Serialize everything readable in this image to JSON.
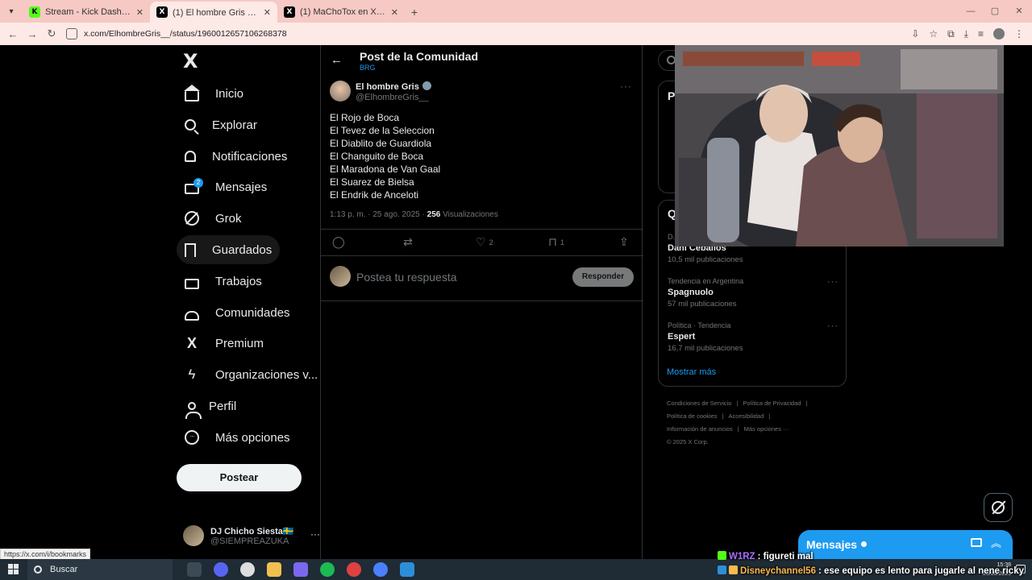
{
  "browser": {
    "tabs": [
      {
        "title": "Stream - Kick Dashboard",
        "favicon": "K",
        "favicon_color": "#53fc18",
        "active": false
      },
      {
        "title": "(1) El hombre Gris ◯ en X: \"@...",
        "favicon": "X",
        "favicon_color": "#000000",
        "active": true
      },
      {
        "title": "(1) MaChoTox en X: \"La verdad...",
        "favicon": "X",
        "favicon_color": "#000000",
        "active": false
      }
    ],
    "new_tab": "+",
    "url": "x.com/ElhombreGris__/status/1960012657106268378",
    "status_url": "https://x.com/i/bookmarks"
  },
  "nav": {
    "logo": "X",
    "items": [
      {
        "label": "Inicio",
        "icon": "home-icon"
      },
      {
        "label": "Explorar",
        "icon": "search-icon"
      },
      {
        "label": "Notificaciones",
        "icon": "bell-icon"
      },
      {
        "label": "Mensajes",
        "icon": "mail-icon",
        "badge": "2"
      },
      {
        "label": "Grok",
        "icon": "grok-icon"
      },
      {
        "label": "Guardados",
        "icon": "bookmark-icon"
      },
      {
        "label": "Trabajos",
        "icon": "briefcase-icon"
      },
      {
        "label": "Comunidades",
        "icon": "communities-icon"
      },
      {
        "label": "Premium",
        "icon": "x-icon"
      },
      {
        "label": "Organizaciones v...",
        "icon": "bolt-icon"
      },
      {
        "label": "Perfil",
        "icon": "person-icon"
      },
      {
        "label": "Más opciones",
        "icon": "more-icon"
      }
    ],
    "post_button": "Postear",
    "account": {
      "name": "DJ Chicho Siesta🇸🇪",
      "handle": "@SIEMPREAZUKA",
      "menu": "···"
    }
  },
  "main": {
    "back": "←",
    "title": "Post de la Comunidad",
    "subtitle": "BRG",
    "post": {
      "author_name": "El hombre Gris",
      "author_handle": "@ElhombreGris__",
      "more": "···",
      "lines": [
        "El Rojo de Boca",
        "El Tevez de la Seleccion",
        "El Diablito de Guardiola",
        "El Changuito de Boca",
        "El Maradona de Van Gaal",
        "El Suarez de Bielsa",
        "El Endrik de Anceloti"
      ],
      "time": "1:13 p. m. · 25 ago. 2025 · ",
      "views_count": "256",
      "views_label": " Visualizaciones",
      "actions": {
        "reply": "",
        "repost": "",
        "like": "2",
        "bookmark": "1"
      }
    },
    "reply": {
      "placeholder": "Postea tu respuesta",
      "button": "Responder"
    }
  },
  "right": {
    "panel_top_heading": "P",
    "trends_heading": "Q",
    "trends": [
      {
        "context": "D...",
        "name": "Dani Ceballos",
        "count": "10,5 mil publicaciones"
      },
      {
        "context": "Tendencia en Argentina",
        "name": "Spagnuolo",
        "count": "57 mil publicaciones"
      },
      {
        "context": "Política · Tendencia",
        "name": "Espert",
        "count": "16,7 mil publicaciones"
      }
    ],
    "show_more": "Mostrar más",
    "footer": [
      "Condiciones de Servicio",
      "|",
      "Política de Privacidad",
      "|",
      "Política de cookies",
      "|",
      "Accesibilidad",
      "|",
      "Información de anuncios",
      "|",
      "Más opciones ···",
      "© 2025 X Corp."
    ]
  },
  "messages_drawer": {
    "title": "Mensajes"
  },
  "taskbar": {
    "search": "Buscar",
    "time": "15:38",
    "date": "25/08/2025"
  },
  "chat": [
    {
      "user": "W1RZ",
      "message": ": figureti mal",
      "color": "#53fc18"
    },
    {
      "user": "Disneychannel56",
      "message": ": ese equipo es lento para jugarle al nene ricky",
      "color": "#ffb84d"
    }
  ]
}
